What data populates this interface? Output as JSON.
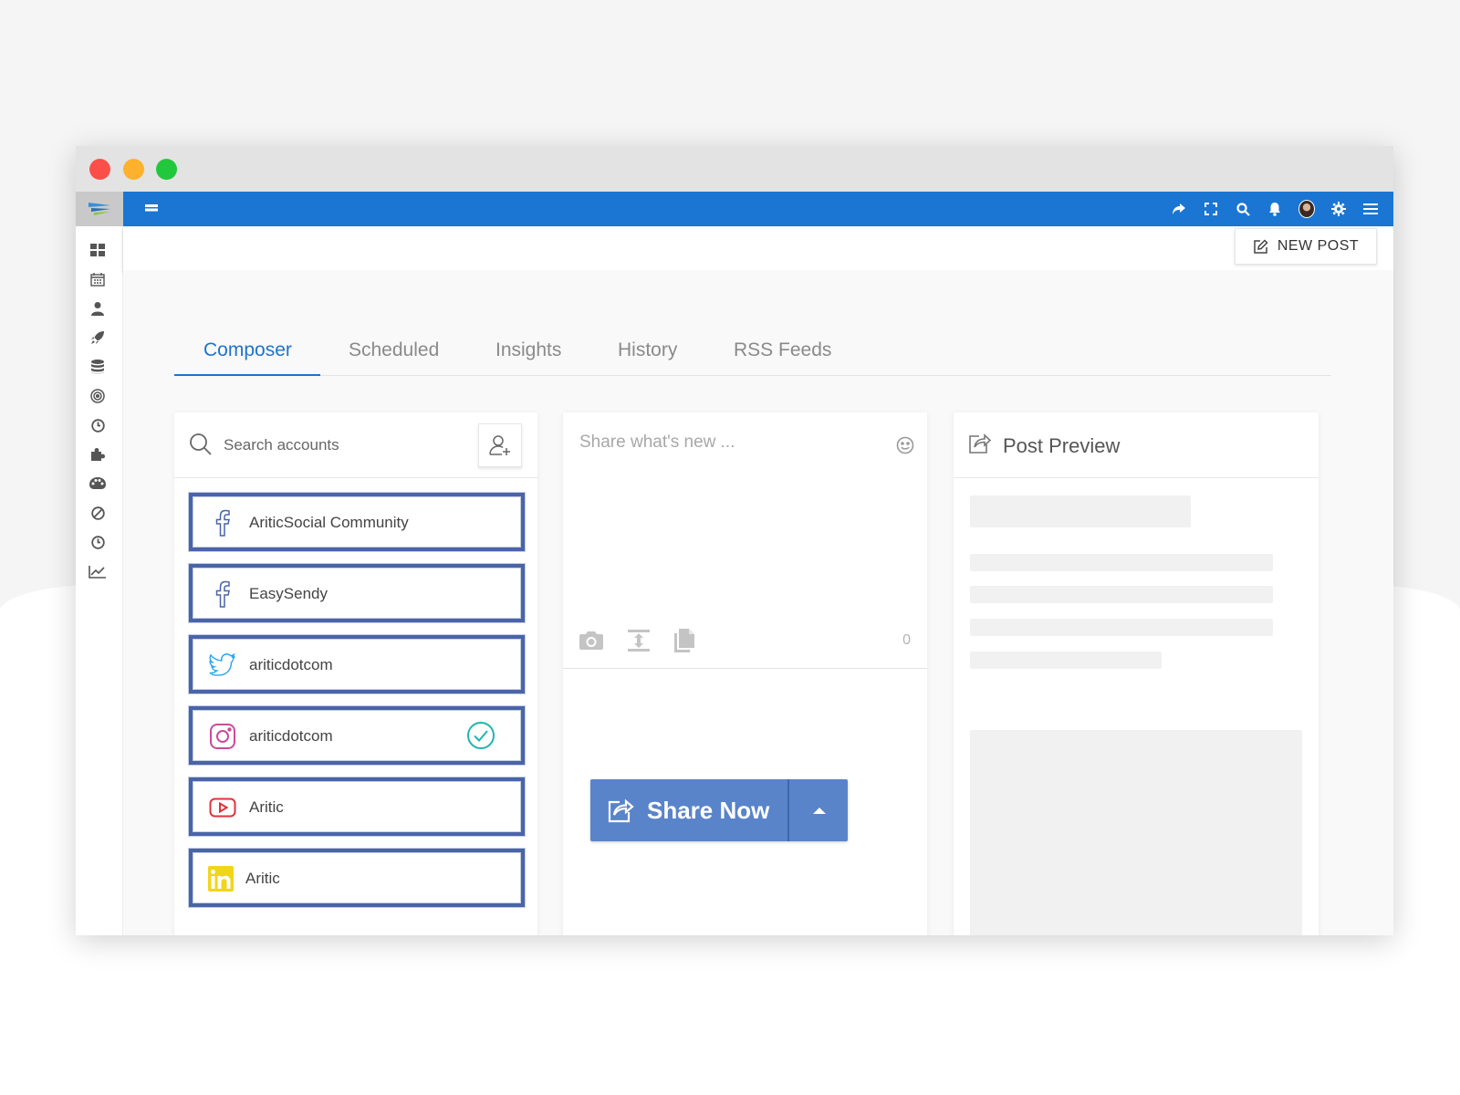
{
  "nav_tabs": [
    {
      "label": "Composer",
      "active": true
    },
    {
      "label": "Scheduled",
      "active": false
    },
    {
      "label": "Insights",
      "active": false
    },
    {
      "label": "History",
      "active": false
    },
    {
      "label": "RSS Feeds",
      "active": false
    }
  ],
  "header": {
    "new_post_label": "NEW POST"
  },
  "accounts_panel": {
    "search_placeholder": "Search accounts",
    "accounts": [
      {
        "network": "facebook",
        "icon": "facebook-icon",
        "name": "AriticSocial Community",
        "selected": false
      },
      {
        "network": "facebook",
        "icon": "facebook-icon",
        "name": "EasySendy",
        "selected": false
      },
      {
        "network": "twitter",
        "icon": "twitter-icon",
        "name": "ariticdotcom",
        "selected": false
      },
      {
        "network": "instagram",
        "icon": "instagram-icon",
        "name": "ariticdotcom",
        "selected": true
      },
      {
        "network": "youtube",
        "icon": "youtube-icon",
        "name": "Aritic",
        "selected": false
      },
      {
        "network": "linkedin",
        "icon": "linkedin-icon",
        "name": "Aritic",
        "selected": false
      }
    ]
  },
  "composer": {
    "placeholder": "Share what's new ...",
    "char_count": "0",
    "share_label": "Share Now"
  },
  "preview": {
    "title": "Post Preview"
  },
  "colors": {
    "topbar": "#1a76d2",
    "active_tab": "#1e74c8",
    "account_border": "#4a64a8",
    "share_button": "#5a84c9",
    "selected_check": "#1fb5b3"
  },
  "icons": {
    "topbar": [
      "share-icon",
      "fullscreen-icon",
      "search-icon",
      "bell-icon",
      "avatar",
      "gear-icon",
      "menu-icon"
    ],
    "sidebar": [
      "dashboard-icon",
      "calendar-icon",
      "user-icon",
      "rocket-icon",
      "database-icon",
      "target-icon",
      "clock-icon",
      "puzzle-icon",
      "palette-icon",
      "ban-icon",
      "history-icon",
      "chart-icon"
    ]
  }
}
